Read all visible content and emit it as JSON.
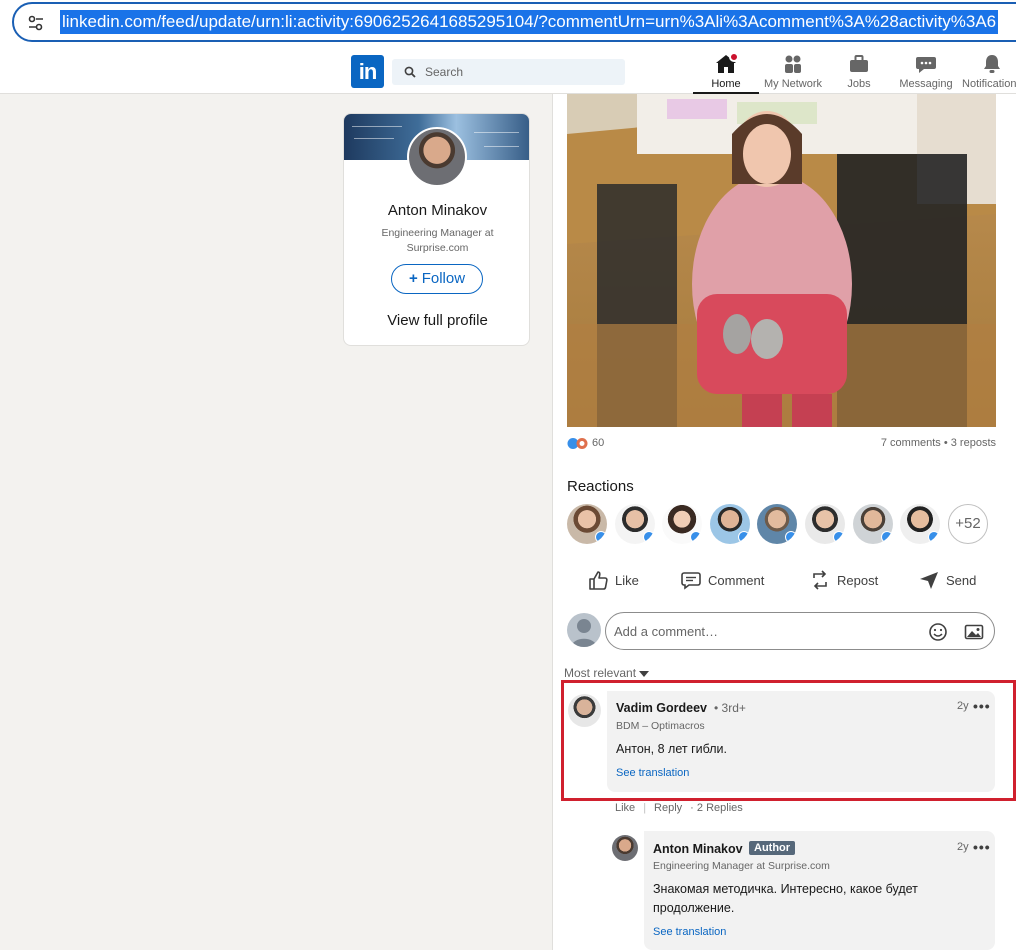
{
  "browser": {
    "url": "linkedin.com/feed/update/urn:li:activity:6906252641685295104/?commentUrn=urn%3Ali%3Acomment%3A%28activity%3A6"
  },
  "nav": {
    "search_placeholder": "Search",
    "items": [
      {
        "label": "Home",
        "icon": "home-icon",
        "active": true
      },
      {
        "label": "My Network",
        "icon": "network-icon"
      },
      {
        "label": "Jobs",
        "icon": "briefcase-icon"
      },
      {
        "label": "Messaging",
        "icon": "messaging-icon"
      },
      {
        "label": "Notifications",
        "icon": "bell-icon"
      }
    ]
  },
  "profile": {
    "name": "Anton Minakov",
    "title": "Engineering Manager at Surprise.com",
    "follow_label": "Follow",
    "view_profile_label": "View full profile"
  },
  "post": {
    "reaction_count": "60",
    "comments_reposts": "7 comments • 3 reposts",
    "reactions_title": "Reactions",
    "more_reactors": "+52",
    "actions": {
      "like": "Like",
      "comment": "Comment",
      "repost": "Repost",
      "send": "Send"
    },
    "comment_placeholder": "Add a comment…",
    "sort_label": "Most relevant"
  },
  "comments": [
    {
      "name": "Vadim Gordeev",
      "degree": "• 3rd+",
      "headline": "BDM – Optimacros",
      "text": "Антон, 8 лет гибли.",
      "translate": "See translation",
      "time": "2y",
      "more": "•••",
      "actions": {
        "like": "Like",
        "reply": "Reply",
        "replies": "· 2 Replies"
      }
    },
    {
      "name": "Anton Minakov",
      "badge": "Author",
      "headline": "Engineering Manager at Surprise.com",
      "text": "Знакомая методичка. Интересно, какое будет продолжение.",
      "translate": "See translation",
      "time": "2y",
      "more": "•••"
    }
  ],
  "colors": {
    "brand": "#0a66c2",
    "highlight": "#d0202e",
    "notification": "#cb112d"
  }
}
